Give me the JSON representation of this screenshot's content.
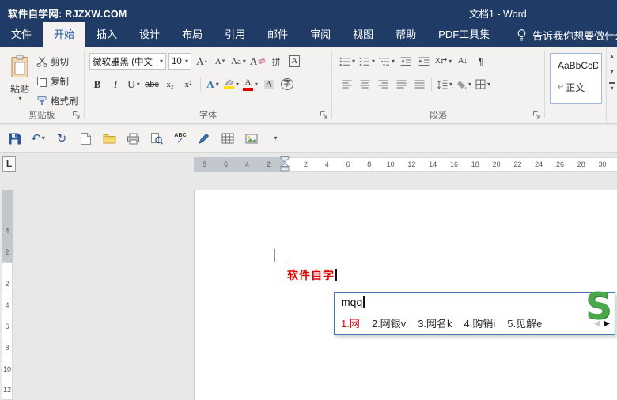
{
  "colors": {
    "titlebar": "#1f3b66",
    "accent": "#2b579a",
    "document_text_red": "#e00000",
    "ime_border": "#4674b9",
    "logo_green": "#4aa84a",
    "highlight_yellow": "#ffe100"
  },
  "title_bar": {
    "app_title": "软件自学网: RJZXW.COM",
    "doc_title": "文档1 - Word"
  },
  "ribbon_tabs": [
    {
      "label": "文件"
    },
    {
      "label": "开始",
      "selected": true
    },
    {
      "label": "插入"
    },
    {
      "label": "设计"
    },
    {
      "label": "布局"
    },
    {
      "label": "引用"
    },
    {
      "label": "邮件"
    },
    {
      "label": "审阅"
    },
    {
      "label": "视图"
    },
    {
      "label": "帮助"
    },
    {
      "label": "PDF工具集"
    }
  ],
  "tell_me": "告诉我你想要做什么",
  "clipboard_group": {
    "label": "剪贴板",
    "paste": "粘贴",
    "cut": "剪切",
    "copy": "复制",
    "format_painter": "格式刷"
  },
  "font_group": {
    "label": "字体",
    "font_name": "微软雅黑 (中文",
    "font_size": "10",
    "bold": "B",
    "italic": "I",
    "underline": "U",
    "strikethrough": "abc",
    "subscript": "x₂",
    "superscript": "x²",
    "grow": "A",
    "shrink": "A",
    "change_case": "Aa",
    "clear_format": "A",
    "phonetic": "拼",
    "char_border": "A",
    "text_effects": "A",
    "font_color": "A",
    "char_shading": "A",
    "enclose": "字"
  },
  "paragraph_group": {
    "label": "段落",
    "pilcrow": "¶",
    "sort": "A↓",
    "asian_layout": "X⇄"
  },
  "styles_group": {
    "preview": "AaBbCcDdt",
    "name": "正文",
    "return_mark": "↵"
  },
  "qat": {
    "icons": [
      "save",
      "undo",
      "redo",
      "new-document",
      "open",
      "quick-print",
      "print-preview",
      "spelling",
      "pen",
      "insert-table",
      "insert-picture",
      "customize"
    ]
  },
  "ruler": {
    "tab_selector": "L",
    "margin_numbers": [
      "8",
      "6",
      "4",
      "2"
    ],
    "main_numbers": [
      "2",
      "4",
      "6",
      "8",
      "10",
      "12",
      "14",
      "16",
      "18",
      "20",
      "22",
      "24",
      "26",
      "28",
      "30"
    ],
    "v_margin_numbers": [
      "4",
      "2"
    ],
    "v_main_numbers": [
      "2",
      "4",
      "6",
      "8",
      "10",
      "12"
    ]
  },
  "document": {
    "text": "软件自学"
  },
  "ime": {
    "input": "mqq",
    "candidates": [
      {
        "text": "1.网",
        "highlighted": true
      },
      {
        "text": "2.网银v"
      },
      {
        "text": "3.网名k"
      },
      {
        "text": "4.购销i"
      },
      {
        "text": "5.见解e"
      }
    ],
    "prev": "◀",
    "next": "▶",
    "logo": "S"
  },
  "glyphs": {
    "caret": "▾",
    "up": "▴",
    "check": "✓",
    "undo": "↶",
    "redo": "↻",
    "abc": "ABC"
  }
}
